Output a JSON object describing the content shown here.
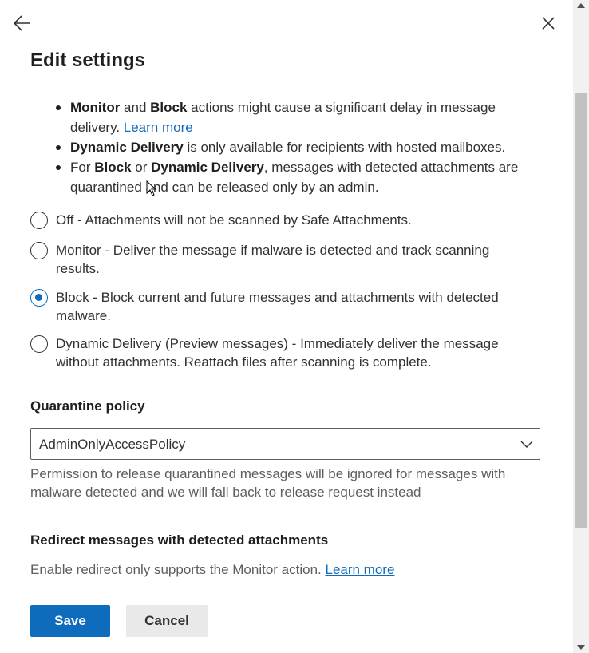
{
  "header": {
    "back_icon": "arrow-left-icon",
    "close_icon": "close-icon",
    "title": "Edit settings"
  },
  "notes": [
    {
      "bold1": "Monitor",
      "text1": " and ",
      "bold2": "Block",
      "text2": " actions might cause a significant delay in message delivery. ",
      "link": "Learn more"
    },
    {
      "bold1": "Dynamic Delivery",
      "text1": " is only available for recipients with hosted mailboxes."
    },
    {
      "text0": "For ",
      "bold1": "Block",
      "text1": " or ",
      "bold2": "Dynamic Delivery",
      "text2": ", messages with detected attachments are quarantined and can be released only by an admin."
    }
  ],
  "actions": {
    "selected": "block",
    "options": [
      {
        "id": "off",
        "label": "Off - Attachments will not be scanned by Safe Attachments."
      },
      {
        "id": "monitor",
        "label": "Monitor - Deliver the message if malware is detected and track scanning results."
      },
      {
        "id": "block",
        "label": "Block - Block current and future messages and attachments with detected malware."
      },
      {
        "id": "dynamic",
        "label": "Dynamic Delivery (Preview messages) - Immediately deliver the message without attachments. Reattach files after scanning is complete."
      }
    ]
  },
  "quarantine": {
    "label": "Quarantine policy",
    "value": "AdminOnlyAccessPolicy",
    "help": "Permission to release quarantined messages will be ignored for messages with malware detected and we will fall back to release request instead"
  },
  "redirect": {
    "label": "Redirect messages with detected attachments",
    "text": "Enable redirect only supports the Monitor action. ",
    "link": "Learn more"
  },
  "footer": {
    "save_label": "Save",
    "cancel_label": "Cancel"
  },
  "colors": {
    "accent": "#0f6cbd",
    "text": "#323130",
    "secondary_text": "#605e5c"
  }
}
